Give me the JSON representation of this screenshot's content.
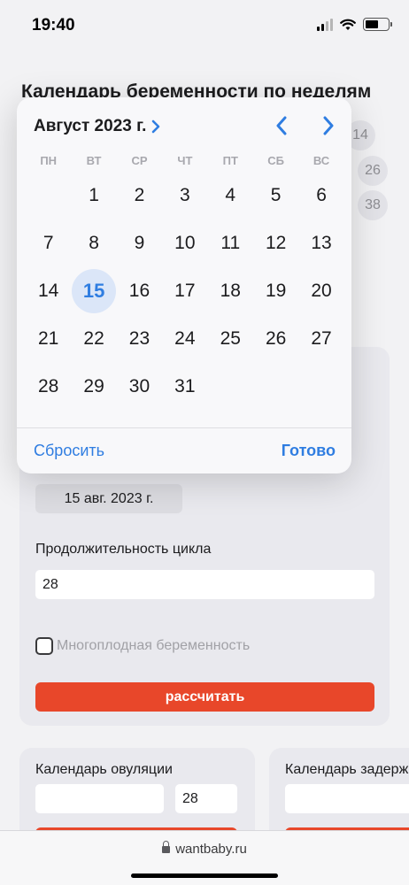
{
  "status": {
    "time": "19:40"
  },
  "page": {
    "title": "Календарь беременности по неделям"
  },
  "bg_circles": [
    "14",
    "26",
    "38"
  ],
  "form": {
    "date_value": "15 авг. 2023 г.",
    "cycle_label": "Продолжительность цикла",
    "cycle_value": "28",
    "multiple_label": "Многоплодная беременность",
    "calc_button": "рассчитать"
  },
  "ovulation": {
    "title": "Календарь овуляции",
    "value": "28"
  },
  "delay": {
    "title": "Календарь задерж"
  },
  "browser": {
    "url": "wantbaby.ru"
  },
  "picker": {
    "month_label": "Август 2023 г.",
    "weekdays": [
      "ПН",
      "ВТ",
      "СР",
      "ЧТ",
      "ПТ",
      "СБ",
      "ВС"
    ],
    "days": [
      "",
      "1",
      "2",
      "3",
      "4",
      "5",
      "6",
      "7",
      "8",
      "9",
      "10",
      "11",
      "12",
      "13",
      "14",
      "15",
      "16",
      "17",
      "18",
      "19",
      "20",
      "21",
      "22",
      "23",
      "24",
      "25",
      "26",
      "27",
      "28",
      "29",
      "30",
      "31"
    ],
    "selected_day": "15",
    "reset": "Сбросить",
    "done": "Готово"
  },
  "colors": {
    "accent": "#2f7de1",
    "button": "#e8472a",
    "selected_bg": "#dbe6f8"
  }
}
